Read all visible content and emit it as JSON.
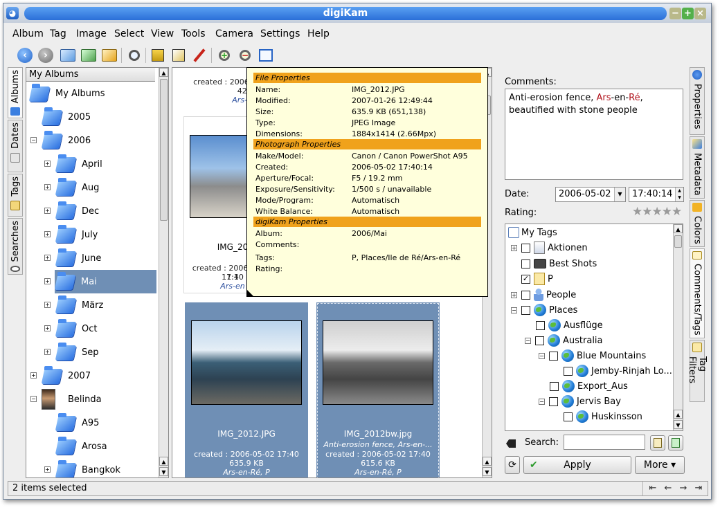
{
  "window": {
    "title": "digiKam",
    "app_icon": "digikam-icon"
  },
  "menubar": [
    "Album",
    "Tag",
    "Image",
    "Select",
    "View",
    "Tools",
    "Camera",
    "Settings",
    "Help"
  ],
  "left_tabs": [
    "Albums",
    "Dates",
    "Tags",
    "Searches"
  ],
  "right_tabs": [
    "Properties",
    "Metadata",
    "Colors",
    "Comments/Tags",
    "Tag Filters"
  ],
  "albums": {
    "header": "My Albums",
    "root": "My Albums",
    "items": [
      {
        "label": "2005"
      },
      {
        "label": "2006"
      },
      {
        "label": "April"
      },
      {
        "label": "Aug"
      },
      {
        "label": "Dec"
      },
      {
        "label": "July"
      },
      {
        "label": "June"
      },
      {
        "label": "Mai",
        "selected": true
      },
      {
        "label": "März"
      },
      {
        "label": "Oct"
      },
      {
        "label": "Sep"
      },
      {
        "label": "2007"
      },
      {
        "label": "Belinda"
      },
      {
        "label": "A95"
      },
      {
        "label": "Arosa"
      },
      {
        "label": "Bangkok"
      }
    ]
  },
  "icon_view": {
    "top_item": {
      "created": "created : 2006-05-02 17:40",
      "size": "429.",
      "tags": "Ars-en-"
    },
    "mid_item": {
      "name": "IMG_20",
      "created": "created : 2006-05-02 17:40",
      "size": "1.1",
      "tags": "Ars-en"
    },
    "item1": {
      "name": "IMG_2012.JPG",
      "created": "created : 2006-05-02 17:40",
      "size": "635.9 KB",
      "tags": "Ars-en-Ré, P"
    },
    "item2": {
      "name": "IMG_2012bw.jpg",
      "comment": "Anti-erosion fence, Ars-en-...",
      "created": "created : 2006-05-02 17:40",
      "size": "615.6 KB",
      "tags": "Ars-en-Ré, P"
    }
  },
  "tooltip": {
    "file_header": "File Properties",
    "file": [
      {
        "k": "Name:",
        "v": "IMG_2012.JPG"
      },
      {
        "k": "Modified:",
        "v": "2007-01-26 12:49:44"
      },
      {
        "k": "Size:",
        "v": "635.9 KB (651,138)"
      },
      {
        "k": "Type:",
        "v": "JPEG Image"
      },
      {
        "k": "Dimensions:",
        "v": "1884x1414 (2.66Mpx)"
      }
    ],
    "photo_header": "Photograph Properties",
    "photo": [
      {
        "k": "Make/Model:",
        "v": "Canon / Canon PowerShot A95"
      },
      {
        "k": "Created:",
        "v": "2006-05-02 17:40:14"
      },
      {
        "k": "Aperture/Focal:",
        "v": "F5 / 19.2 mm"
      },
      {
        "k": "Exposure/Sensitivity:",
        "v": "1/500 s / unavailable"
      },
      {
        "k": "Mode/Program:",
        "v": "Automatisch"
      },
      {
        "k": "White Balance:",
        "v": "Automatisch"
      }
    ],
    "digikam_header": "digiKam Properties",
    "digikam": [
      {
        "k": "Album:",
        "v": "2006/Mai"
      },
      {
        "k": "Comments:",
        "v": ""
      },
      {
        "k": "Tags:",
        "v": "P, Places/Ile de Ré/Ars-en-Ré"
      },
      {
        "k": "Rating:",
        "v": ""
      }
    ]
  },
  "right_panel": {
    "comments_label": "Comments:",
    "comment_parts": [
      "Anti-erosion fence, ",
      "Ars",
      "-en-",
      "Ré",
      ",",
      "beautified with stone people"
    ],
    "date_label": "Date:",
    "date_value": "2006-05-02",
    "time_value": "17:40:14",
    "rating_label": "Rating:",
    "rating_stars": "★★★★★",
    "rating_value": 0,
    "tags_root": "My Tags",
    "tags": [
      {
        "label": "Aktionen",
        "checked": false
      },
      {
        "label": "Best Shots",
        "checked": false
      },
      {
        "label": "P",
        "checked": true
      },
      {
        "label": "People",
        "checked": false
      },
      {
        "label": "Places",
        "checked": false
      },
      {
        "label": "Ausflüge",
        "checked": false
      },
      {
        "label": "Australia",
        "checked": false
      },
      {
        "label": "Blue Mountains",
        "checked": false
      },
      {
        "label": "Jemby-Rinjah Lo...",
        "checked": false
      },
      {
        "label": "Export_Aus",
        "checked": false
      },
      {
        "label": "Jervis Bay",
        "checked": false
      },
      {
        "label": "Huskinsson",
        "checked": false
      }
    ],
    "search_label": "Search:",
    "search_value": "",
    "apply_label": "Apply",
    "more_label": "More ▾"
  },
  "status": {
    "text": "2 items selected"
  },
  "colors": {
    "selection": "#6f8fb5",
    "tooltip_bg": "#ffffdc",
    "tooltip_header": "#f0a21c",
    "title_blue": "#2b6fd8"
  }
}
